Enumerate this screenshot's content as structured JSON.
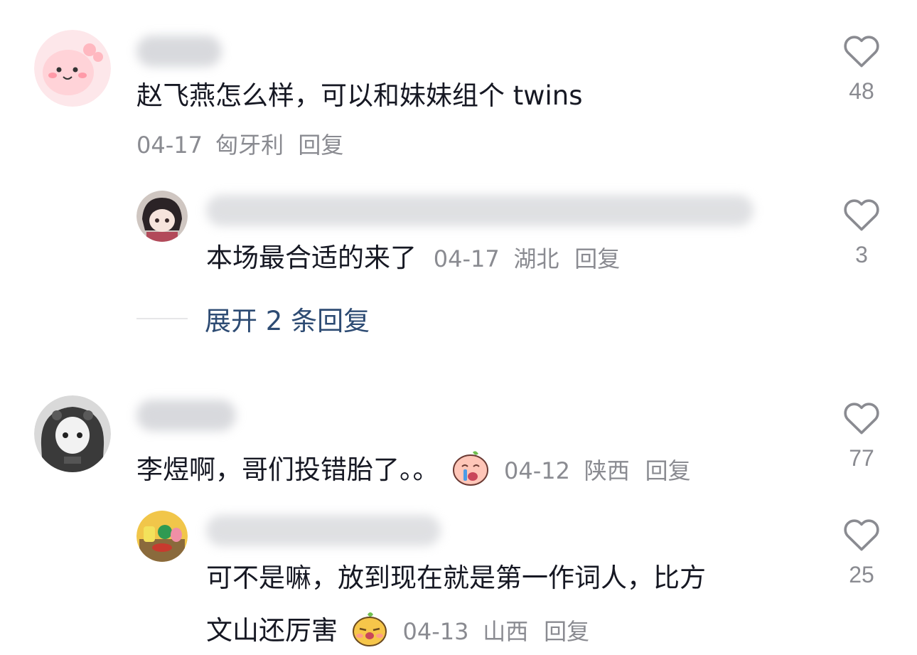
{
  "comments": [
    {
      "text": "赵飞燕怎么样，可以和妹妹组个 twins",
      "date": "04-17",
      "location": "匈牙利",
      "reply_label": "回复",
      "likes": "48",
      "replies": [
        {
          "text": "本场最合适的来了",
          "date": "04-17",
          "location": "湖北",
          "reply_label": "回复",
          "likes": "3"
        }
      ],
      "expand_label": "展开 2 条回复"
    },
    {
      "text": "李煜啊，哥们投错胎了。。",
      "date": "04-12",
      "location": "陕西",
      "reply_label": "回复",
      "likes": "77",
      "replies": [
        {
          "text_line1": "可不是嘛，放到现在就是第一作词人，比方",
          "text_line2": "文山还厉害",
          "date": "04-13",
          "location": "山西",
          "reply_label": "回复",
          "likes": "25"
        }
      ]
    }
  ],
  "icons": {
    "like": "heart-outline-icon",
    "emoji_cry": "crying-emoji-icon",
    "emoji_smug": "smug-emoji-icon"
  },
  "colors": {
    "text": "#161823",
    "meta": "#8a8b91",
    "link": "#2d4b73"
  }
}
